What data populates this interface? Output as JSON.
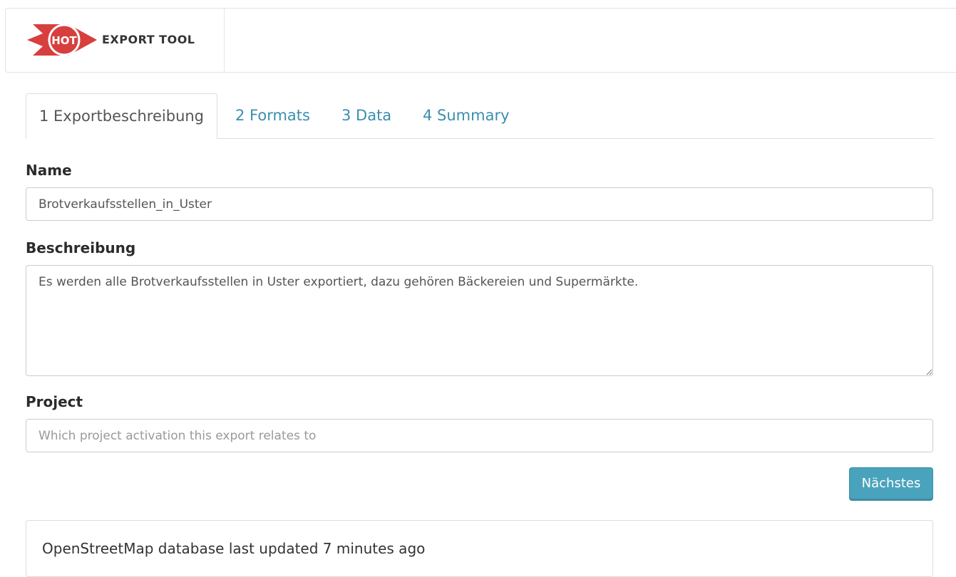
{
  "app": {
    "brand_mark": "HOT",
    "brand_name": "EXPORT TOOL",
    "brand_color": "#d73f3f"
  },
  "tabs": [
    {
      "label": "1 Exportbeschreibung",
      "active": true
    },
    {
      "label": "2 Formats",
      "active": false
    },
    {
      "label": "3 Data",
      "active": false
    },
    {
      "label": "4 Summary",
      "active": false
    }
  ],
  "form": {
    "name_label": "Name",
    "name_value": "Brotverkaufsstellen_in_Uster",
    "description_label": "Beschreibung",
    "description_value": "Es werden alle Brotverkaufsstellen in Uster exportiert, dazu gehören Bäckereien und Supermärkte.",
    "project_label": "Project",
    "project_value": "",
    "project_placeholder": "Which project activation this export relates to",
    "next_button": "Nächstes"
  },
  "status": {
    "message": "OpenStreetMap database last updated 7 minutes ago"
  },
  "colors": {
    "accent": "#4aa3bc",
    "tab_link": "#3a8fb0"
  }
}
